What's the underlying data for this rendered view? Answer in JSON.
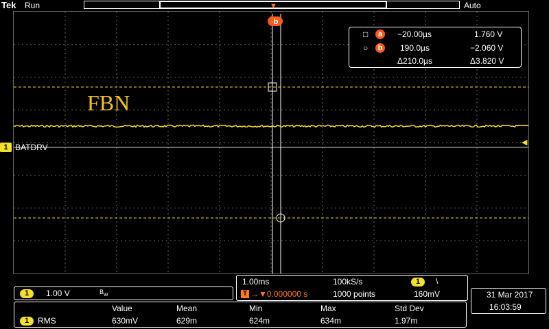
{
  "header": {
    "brand": "Tek",
    "status": "Run",
    "trigger_mode": "Auto"
  },
  "waveform": {
    "label": "FBN",
    "channel_marker": "1",
    "channel_name": "BATDRV"
  },
  "cursors": {
    "a_badge": "a",
    "b_badge": "b",
    "a_time": "−20.00µs",
    "a_volt": "1.760 V",
    "b_time": "190.0µs",
    "b_volt": "−2.060 V",
    "delta_time": "Δ210.0µs",
    "delta_volt": "Δ3.820 V"
  },
  "channel_panel": {
    "channel": "1",
    "scale": "1.00 V",
    "bw": "B",
    "bw_sub": "W"
  },
  "acquisition": {
    "timebase": "1.00ms",
    "sample_rate": "100kS/s",
    "trigger_channel": "1",
    "trigger_slope": "\\",
    "trigger_badge": "T",
    "trigger_position": "→▼0.000000 s",
    "record_length": "1000 points",
    "trigger_level": "160mV"
  },
  "datetime": {
    "date": "31 Mar  2017",
    "time": "16:03:59"
  },
  "measurements": {
    "headers": [
      "Value",
      "Mean",
      "Min",
      "Max",
      "Std Dev"
    ],
    "rows": [
      {
        "channel": "1",
        "type": "RMS",
        "values": [
          "630mV",
          "629m",
          "624m",
          "634m",
          "1.97m"
        ]
      }
    ]
  },
  "colors": {
    "trace": "#f5e02a",
    "cursor_badge": "#ff5a1e",
    "label": "#f5c518",
    "grid": "#6a6a6a"
  }
}
